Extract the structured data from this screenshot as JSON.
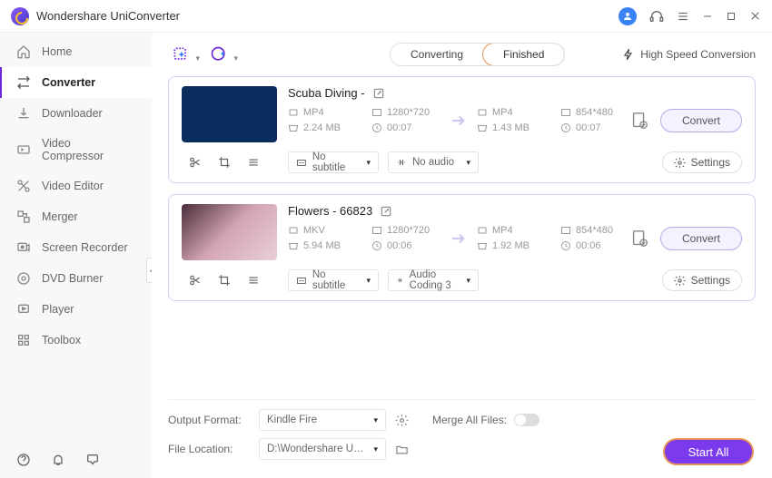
{
  "app_title": "Wondershare UniConverter",
  "sidebar": {
    "items": [
      {
        "label": "Home",
        "icon": "home"
      },
      {
        "label": "Converter",
        "icon": "converter"
      },
      {
        "label": "Downloader",
        "icon": "downloader"
      },
      {
        "label": "Video Compressor",
        "icon": "compressor"
      },
      {
        "label": "Video Editor",
        "icon": "editor"
      },
      {
        "label": "Merger",
        "icon": "merger"
      },
      {
        "label": "Screen Recorder",
        "icon": "recorder"
      },
      {
        "label": "DVD Burner",
        "icon": "dvd"
      },
      {
        "label": "Player",
        "icon": "player"
      },
      {
        "label": "Toolbox",
        "icon": "toolbox"
      }
    ]
  },
  "topbar": {
    "tabs": {
      "converting": "Converting",
      "finished": "Finished"
    },
    "high_speed": "High Speed Conversion"
  },
  "files": [
    {
      "title": "Scuba Diving -",
      "src": {
        "format": "MP4",
        "res": "1280*720",
        "size": "2.24 MB",
        "dur": "00:07"
      },
      "dst": {
        "format": "MP4",
        "res": "854*480",
        "size": "1.43 MB",
        "dur": "00:07"
      },
      "subtitle": "No subtitle",
      "audio": "No audio",
      "convert_label": "Convert",
      "settings_label": "Settings"
    },
    {
      "title": "Flowers - 66823",
      "src": {
        "format": "MKV",
        "res": "1280*720",
        "size": "5.94 MB",
        "dur": "00:06"
      },
      "dst": {
        "format": "MP4",
        "res": "854*480",
        "size": "1.92 MB",
        "dur": "00:06"
      },
      "subtitle": "No subtitle",
      "audio": "Audio Coding 3",
      "convert_label": "Convert",
      "settings_label": "Settings"
    }
  ],
  "bottom": {
    "output_format_label": "Output Format:",
    "output_format_value": "Kindle Fire",
    "file_location_label": "File Location:",
    "file_location_value": "D:\\Wondershare UniConverter",
    "merge_label": "Merge All Files:",
    "start_all": "Start All"
  }
}
